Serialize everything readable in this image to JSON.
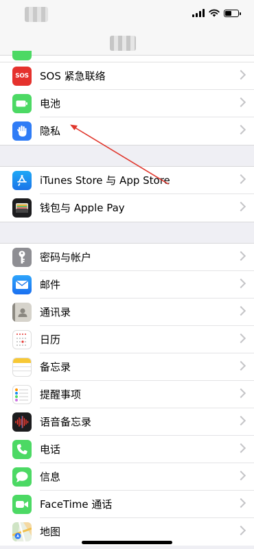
{
  "status_bar": {
    "time": "",
    "icons": [
      "signal-icon",
      "wifi-icon",
      "battery-icon"
    ],
    "battery_level": 0.6
  },
  "nav": {
    "title": ""
  },
  "groups": [
    {
      "items": [
        {
          "id": "sos",
          "label": "SOS 紧急联络",
          "icon": "sos-icon",
          "icon_text": "SOS",
          "color": "#e5322d"
        },
        {
          "id": "battery",
          "label": "电池",
          "icon": "battery-settings-icon",
          "color": "#4cd964"
        },
        {
          "id": "privacy",
          "label": "隐私",
          "icon": "hand-icon",
          "color": "#2f7cf6"
        }
      ]
    },
    {
      "items": [
        {
          "id": "itunes-app-store",
          "label": "iTunes Store 与 App Store",
          "icon": "app-store-icon",
          "color": "#1a8cf0"
        },
        {
          "id": "wallet",
          "label": "钱包与 Apple Pay",
          "icon": "wallet-icon",
          "color": "#1c1c1e"
        }
      ]
    },
    {
      "items": [
        {
          "id": "passwords",
          "label": "密码与帐户",
          "icon": "key-icon",
          "color": "#8e8e93"
        },
        {
          "id": "mail",
          "label": "邮件",
          "icon": "mail-icon",
          "color": "#1a8cf0"
        },
        {
          "id": "contacts",
          "label": "通讯录",
          "icon": "contacts-icon",
          "color": "#b9b6ae"
        },
        {
          "id": "calendar",
          "label": "日历",
          "icon": "calendar-icon",
          "color": "#ffffff"
        },
        {
          "id": "notes",
          "label": "备忘录",
          "icon": "notes-icon",
          "color": "#ffffff"
        },
        {
          "id": "reminders",
          "label": "提醒事项",
          "icon": "reminders-icon",
          "color": "#ffffff"
        },
        {
          "id": "voice-memos",
          "label": "语音备忘录",
          "icon": "voice-memos-icon",
          "color": "#1c1c1e"
        },
        {
          "id": "phone",
          "label": "电话",
          "icon": "phone-icon",
          "color": "#4cd964"
        },
        {
          "id": "messages",
          "label": "信息",
          "icon": "messages-icon",
          "color": "#4cd964"
        },
        {
          "id": "facetime",
          "label": "FaceTime 通话",
          "icon": "facetime-icon",
          "color": "#4cd964"
        },
        {
          "id": "maps",
          "label": "地图",
          "icon": "maps-icon",
          "color": "#e9efe3"
        }
      ]
    }
  ],
  "annotation": {
    "type": "red-arrow",
    "color": "#e0362c",
    "target": "privacy"
  }
}
